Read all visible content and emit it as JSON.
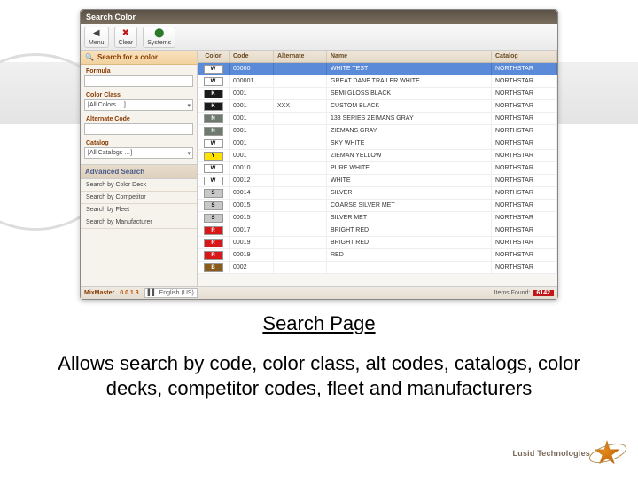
{
  "window": {
    "title": "Search Color"
  },
  "toolbar": {
    "menu": "Menu",
    "clear": "Clear",
    "systems": "Systems"
  },
  "sidebar": {
    "header": "Search for a color",
    "formula_label": "Formula",
    "color_class_label": "Color Class",
    "color_class_value": "[All Colors …]",
    "alt_code_label": "Alternate Code",
    "catalog_label": "Catalog",
    "catalog_value": "[All Catalogs …]",
    "advanced_header": "Advanced Search",
    "adv_items": {
      "deck": "Search by Color Deck",
      "competitor": "Search by Competitor",
      "fleet": "Search by Fleet",
      "manufacturer": "Search by Manufacturer"
    }
  },
  "table": {
    "headers": {
      "color": "Color",
      "code": "Code",
      "alternate": "Alternate",
      "name": "Name",
      "catalog": "Catalog"
    },
    "rows": [
      {
        "sw": "#ffffff",
        "lbl": "W",
        "code": "00000",
        "alt": "",
        "name": "WHITE TEST",
        "cat": "NORTHSTAR",
        "sel": true
      },
      {
        "sw": "#ffffff",
        "lbl": "W",
        "code": "000001",
        "alt": "",
        "name": "GREAT DANE TRAILER WHITE",
        "cat": "NORTHSTAR"
      },
      {
        "sw": "#1a1a1a",
        "lbl": "K",
        "tc": "#fff",
        "code": "0001",
        "alt": "",
        "name": "SEMI GLOSS BLACK",
        "cat": "NORTHSTAR"
      },
      {
        "sw": "#1a1a1a",
        "lbl": "K",
        "tc": "#fff",
        "code": "0001",
        "alt": "XXX",
        "name": "CUSTOM BLACK",
        "cat": "NORTHSTAR"
      },
      {
        "sw": "#6f7a6f",
        "lbl": "N",
        "tc": "#fff",
        "code": "0001",
        "alt": "",
        "name": "133 SERIES ZEIMANS GRAY",
        "cat": "NORTHSTAR"
      },
      {
        "sw": "#6f7a6f",
        "lbl": "N",
        "tc": "#fff",
        "code": "0001",
        "alt": "",
        "name": "ZIEMANS GRAY",
        "cat": "NORTHSTAR"
      },
      {
        "sw": "#ffffff",
        "lbl": "W",
        "code": "0001",
        "alt": "",
        "name": "SKY WHITE",
        "cat": "NORTHSTAR"
      },
      {
        "sw": "#ffe200",
        "lbl": "Y",
        "code": "0001",
        "alt": "",
        "name": "ZIEMAN YELLOW",
        "cat": "NORTHSTAR"
      },
      {
        "sw": "#ffffff",
        "lbl": "W",
        "code": "00010",
        "alt": "",
        "name": "PURE WHITE",
        "cat": "NORTHSTAR"
      },
      {
        "sw": "#ffffff",
        "lbl": "W",
        "code": "00012",
        "alt": "",
        "name": "WHITE",
        "cat": "NORTHSTAR"
      },
      {
        "sw": "#c8c8c8",
        "lbl": "S",
        "code": "00014",
        "alt": "",
        "name": "SILVER",
        "cat": "NORTHSTAR"
      },
      {
        "sw": "#c8c8c8",
        "lbl": "S",
        "code": "00015",
        "alt": "",
        "name": "COARSE SILVER MET",
        "cat": "NORTHSTAR"
      },
      {
        "sw": "#c8c8c8",
        "lbl": "S",
        "code": "00015",
        "alt": "",
        "name": "SILVER MET",
        "cat": "NORTHSTAR"
      },
      {
        "sw": "#d81818",
        "lbl": "R",
        "tc": "#fff",
        "code": "00017",
        "alt": "",
        "name": "BRIGHT RED",
        "cat": "NORTHSTAR"
      },
      {
        "sw": "#d81818",
        "lbl": "R",
        "tc": "#fff",
        "code": "00019",
        "alt": "",
        "name": "BRIGHT RED",
        "cat": "NORTHSTAR"
      },
      {
        "sw": "#d81818",
        "lbl": "R",
        "tc": "#fff",
        "code": "00019",
        "alt": "",
        "name": "RED",
        "cat": "NORTHSTAR"
      },
      {
        "sw": "#8a5a1a",
        "lbl": "B",
        "tc": "#fff",
        "code": "0002",
        "alt": "",
        "name": "",
        "cat": "NORTHSTAR"
      }
    ]
  },
  "status": {
    "app": "MixMaster",
    "version": "0.0.1.3",
    "lang": "English (US)",
    "found_label": "Items Found:",
    "found_count": "6142"
  },
  "caption": "Search Page",
  "description": "Allows search by code, color class, alt codes, catalogs, color decks, competitor codes, fleet and manufacturers",
  "brand": "Lusid Technologies"
}
